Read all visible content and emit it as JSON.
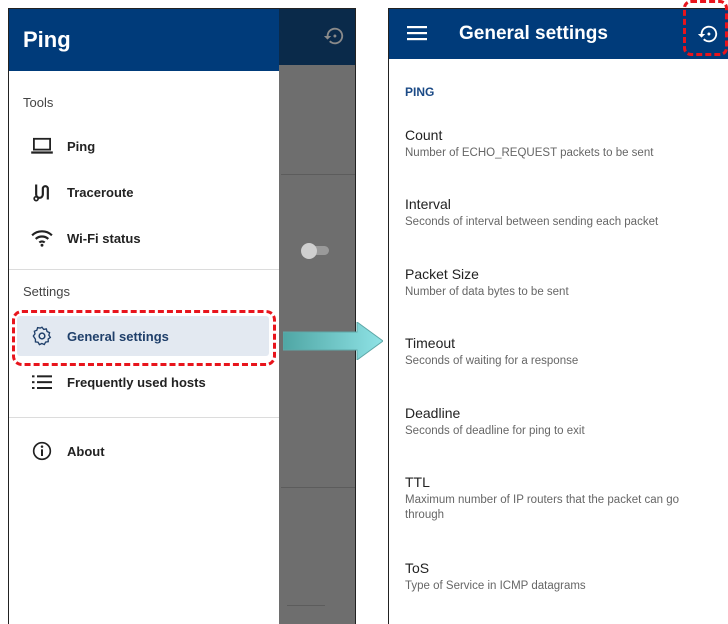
{
  "left": {
    "app_title": "Ping",
    "sections": {
      "tools": "Tools",
      "settings": "Settings"
    },
    "items": {
      "ping": "Ping",
      "traceroute": "Traceroute",
      "wifi": "Wi-Fi status",
      "general": "General settings",
      "hosts": "Frequently used hosts",
      "about": "About"
    }
  },
  "right": {
    "title": "General settings",
    "section": "PING",
    "settings": [
      {
        "title": "Count",
        "summary": "Number of ECHO_REQUEST packets to be sent"
      },
      {
        "title": "Interval",
        "summary": "Seconds of interval between sending each packet"
      },
      {
        "title": "Packet Size",
        "summary": "Number of data bytes to be sent"
      },
      {
        "title": "Timeout",
        "summary": "Seconds of waiting for a response"
      },
      {
        "title": "Deadline",
        "summary": "Seconds of deadline for ping to exit"
      },
      {
        "title": "TTL",
        "summary": "Maximum number of IP routers that the packet can go through"
      },
      {
        "title": "ToS",
        "summary": "Type of Service in ICMP datagrams"
      }
    ]
  },
  "colors": {
    "primary": "#003b7a",
    "highlight": "#e8141c",
    "arrow": "#5fb3b3"
  }
}
